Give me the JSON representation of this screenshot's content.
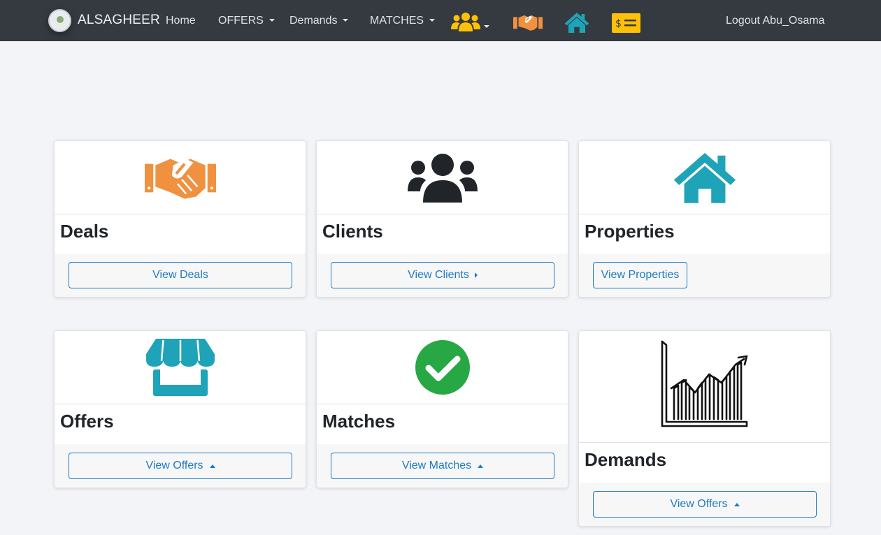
{
  "navbar": {
    "brand": "ALSAGHEER",
    "items": [
      {
        "label": "Home",
        "dropdown": false
      },
      {
        "label": "OFFERS",
        "dropdown": true
      },
      {
        "label": "Demands",
        "dropdown": true
      },
      {
        "label": "MATCHES",
        "dropdown": true
      }
    ],
    "icons": [
      "users-icon",
      "handshake-icon",
      "home-icon",
      "money-check-icon"
    ],
    "logout": "Logout Abu_Osama"
  },
  "colors": {
    "navbar_bg": "#343a40",
    "accent_orange": "#f0913f",
    "accent_teal": "#1fa3b8",
    "accent_green": "#28a745",
    "accent_yellow": "#ffc107",
    "link_blue": "#1f7ac3"
  },
  "cards": [
    {
      "title": "Deals",
      "button": "View Deals",
      "icon": "handshake-icon",
      "caret": "none"
    },
    {
      "title": "Clients",
      "button": "View Clients",
      "icon": "users-icon",
      "caret": "right"
    },
    {
      "title": "Properties",
      "button": "View Properties",
      "icon": "home-icon",
      "caret": "none"
    },
    {
      "title": "Offers",
      "button": "View Offers",
      "icon": "store-icon",
      "caret": "up"
    },
    {
      "title": "Matches",
      "button": "View Matches",
      "icon": "check-circle-icon",
      "caret": "up"
    },
    {
      "title": "Demands",
      "button": "View Offers",
      "icon": "growth-chart-icon",
      "caret": "up"
    }
  ]
}
